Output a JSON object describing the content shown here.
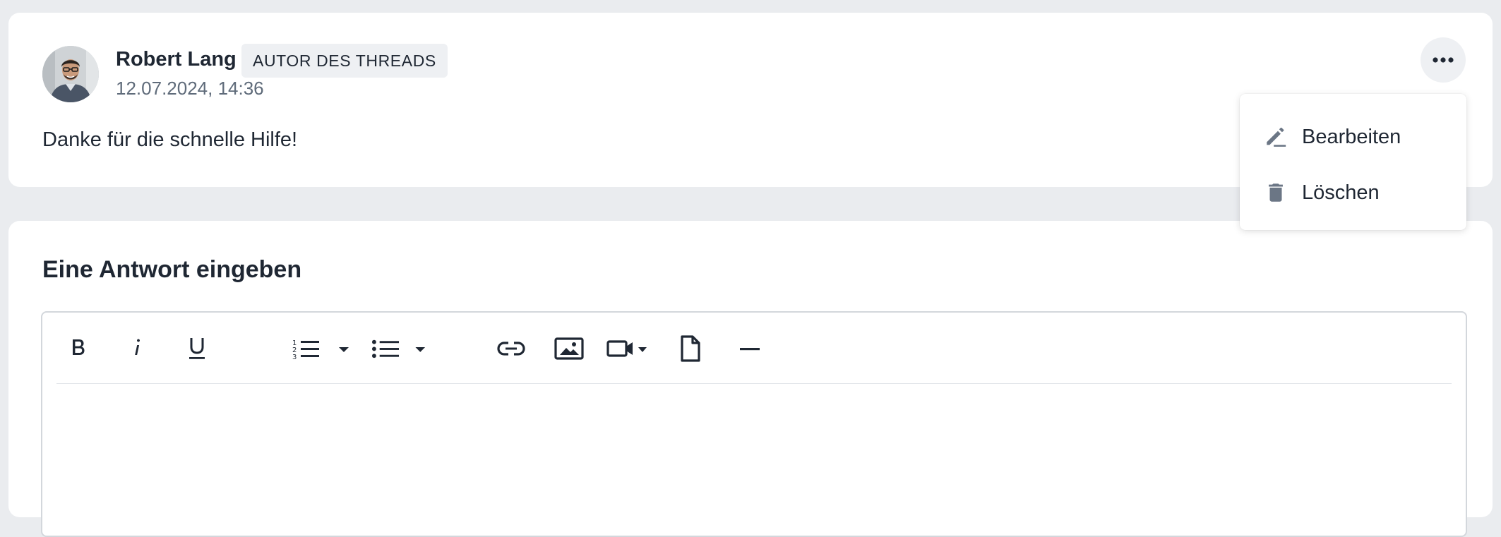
{
  "post": {
    "author": "Robert Lang",
    "badge": "AUTOR DES THREADS",
    "timestamp": "12.07.2024, 14:36",
    "body": "Danke für die schnelle Hilfe!",
    "more_icon": "more-horizontal-icon"
  },
  "menu": {
    "items": [
      {
        "label": "Bearbeiten",
        "icon": "pencil-icon"
      },
      {
        "label": "Löschen",
        "icon": "trash-icon"
      }
    ]
  },
  "reply": {
    "title": "Eine Antwort eingeben",
    "toolbar": [
      "bold-icon",
      "italic-icon",
      "underline-icon",
      "ordered-list-icon",
      "bullet-list-icon",
      "link-icon",
      "image-icon",
      "video-icon",
      "file-icon",
      "horizontal-rule-icon"
    ]
  },
  "colors": {
    "background": "#eaecef",
    "card": "#ffffff",
    "text": "#1f2733",
    "muted": "#5f6b7a",
    "badge_bg": "#eef0f3"
  }
}
